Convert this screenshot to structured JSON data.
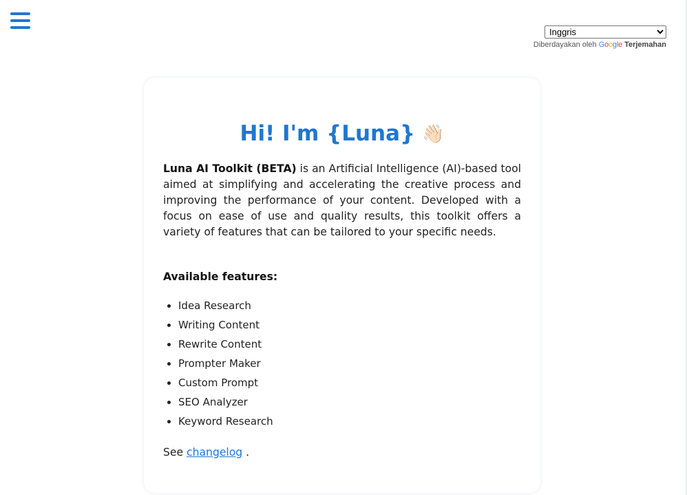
{
  "menu": {
    "icon": "hamburger-menu-icon",
    "color": "#1f77d0"
  },
  "translate": {
    "selected_language": "Inggris",
    "powered_by": "Diberdayakan oleh",
    "google_letters": [
      "G",
      "o",
      "o",
      "g",
      "l",
      "e"
    ],
    "service": "Terjemahan"
  },
  "card": {
    "title": "Hi! I'm {Luna}",
    "title_emoji": "👋🏻",
    "intro_bold": "Luna AI Toolkit (BETA)",
    "intro_text": " is an Artificial Intelligence (AI)-based tool aimed at simplifying and accelerating the creative process and improving the performance of your content. Developed with a focus on ease of use and quality results, this toolkit offers a variety of features that can be tailored to your specific needs.",
    "features_title": "Available features:",
    "features": [
      "Idea Research",
      "Writing Content",
      "Rewrite Content",
      "Prompter Maker",
      "Custom Prompt",
      "SEO Analyzer",
      "Keyword Research"
    ],
    "see_prefix": "See ",
    "changelog_link": "changelog",
    "see_suffix": " ."
  },
  "colors": {
    "accent": "#1f77d0",
    "text": "#222222",
    "background": "#ffffff"
  }
}
